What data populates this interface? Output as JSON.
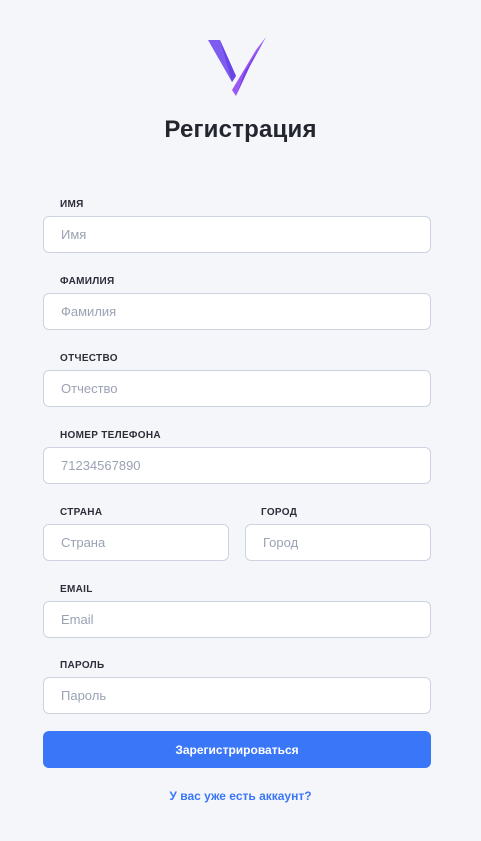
{
  "brand": {
    "logo_icon": "v-logo-icon",
    "accent": "#8a4df0"
  },
  "title": "Регистрация",
  "fields": {
    "first_name": {
      "label": "ИМЯ",
      "placeholder": "Имя",
      "value": ""
    },
    "last_name": {
      "label": "ФАМИЛИЯ",
      "placeholder": "Фамилия",
      "value": ""
    },
    "patronymic": {
      "label": "ОТЧЕСТВО",
      "placeholder": "Отчество",
      "value": ""
    },
    "phone": {
      "label": "НОМЕР ТЕЛЕФОНА",
      "placeholder": "71234567890",
      "value": ""
    },
    "country": {
      "label": "СТРАНА",
      "placeholder": "Страна",
      "value": ""
    },
    "city": {
      "label": "ГОРОД",
      "placeholder": "Город",
      "value": ""
    },
    "email": {
      "label": "EMAIL",
      "placeholder": "Email",
      "value": ""
    },
    "password": {
      "label": "ПАРОЛЬ",
      "placeholder": "Пароль",
      "value": ""
    }
  },
  "submit_label": "Зарегистрироваться",
  "login_link": "У вас уже есть аккаунт?",
  "colors": {
    "primary": "#3a76f8",
    "background": "#f5f6fa",
    "input_border": "#cdd3e0"
  }
}
